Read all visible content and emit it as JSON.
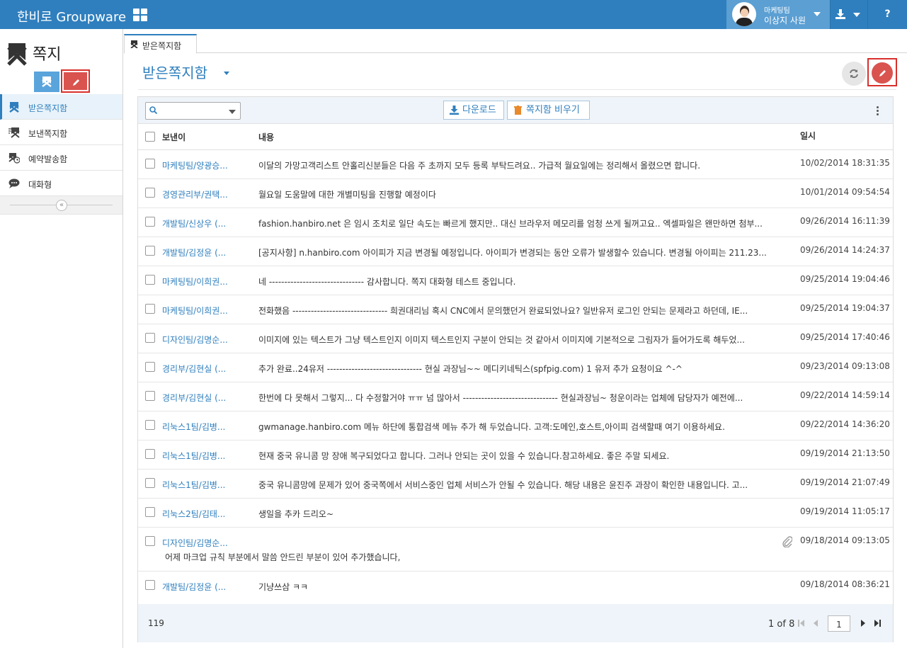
{
  "header": {
    "brand": "한비로 Groupware",
    "user_team": "마케팅팀",
    "user_name": "이상지 사원",
    "help_label": "?"
  },
  "sidebar": {
    "title": "쪽지",
    "items": [
      {
        "label": "받은쪽지함",
        "icon": "inbox-icon",
        "active": true
      },
      {
        "label": "보낸쪽지함",
        "icon": "sent-icon",
        "active": false
      },
      {
        "label": "예약발송함",
        "icon": "scheduled-icon",
        "active": false
      },
      {
        "label": "대화형",
        "icon": "chat-icon",
        "active": false
      }
    ]
  },
  "tab": {
    "label": "받은쪽지함"
  },
  "main": {
    "title": "받은쪽지함",
    "toolbar": {
      "search_placeholder": "",
      "download_label": "다운로드",
      "empty_label": "쪽지함 비우기"
    },
    "columns": {
      "sender": "보낸이",
      "content": "내용",
      "date": "일시"
    },
    "rows": [
      {
        "sender": "마케팅팀/양광승...",
        "content": "이달의 가망고객리스트 안홀리신분들은 다음 주 초까지 모두 등록 부탁드려요.. 가급적 월요일에는 정리해서 올렸으면 합니다.",
        "date": "10/02/2014 18:31:35"
      },
      {
        "sender": "경영관리부/권택...",
        "content": "월요일 도움말에 대한 개별미팅을 진행할 예정이다",
        "date": "10/01/2014 09:54:54"
      },
      {
        "sender": "개발팀/신상우 (...",
        "content": "fashion.hanbiro.net 은 임시 조치로 일단 속도는 빠르게 했지만.. 대신 브라우저 메모리를 엄청 쓰게 될꺼고요.. 엑셀파일은 왠만하면 첨부...",
        "date": "09/26/2014 16:11:39"
      },
      {
        "sender": "개발팀/김정윤 (...",
        "content": "[공지사항] n.hanbiro.com 아이피가 지금 변경될 예정입니다. 아이피가 변경되는 동안 오류가 발생할수 있습니다. 변경될 아이피는 211.23...",
        "date": "09/26/2014 14:24:37"
      },
      {
        "sender": "마케팅팀/이희권...",
        "content": "네 ------------------------------- 감사합니다. 쪽지 대화형 테스트 중입니다.",
        "date": "09/25/2014 19:04:46"
      },
      {
        "sender": "마케팅팀/이희권...",
        "content": "전화했음 ------------------------------- 희권대리님 혹시 CNC에서 문의했던거 완료되었나요? 일반유저 로그인 안되는 문제라고 하던데, IE...",
        "date": "09/25/2014 19:04:37"
      },
      {
        "sender": "디자인팀/김명순...",
        "content": "이미지에 있는 텍스트가 그냥 텍스트인지 이미지 텍스트인지 구분이 안되는 것 같아서 이미지에 기본적으로 그림자가 들어가도록 해두었...",
        "date": "09/25/2014 17:40:46"
      },
      {
        "sender": "경리부/김현실 (...",
        "content": "추가 완료..24유저 ------------------------------- 현실 과장님~~ 메디키네틱스(spfpig.com) 1 유저 추가 요청이요 ^-^",
        "date": "09/23/2014 09:13:08"
      },
      {
        "sender": "경리부/김현실 (...",
        "content": "한번에 다 못해서 그렇지... 다 수정할거야 ㅠㅠ 넘 많아서 ------------------------------- 현실과장님~ 청운이라는 업체에 담당자가 예전에...",
        "date": "09/22/2014 14:59:14"
      },
      {
        "sender": "리눅스1팀/김병...",
        "content": "gwmanage.hanbiro.com 메뉴 하단에 통합검색 메뉴 추가 해 두었습니다. 고객:도메인,호스트,아이피 검색할때 여기 이용하세요.",
        "date": "09/22/2014 14:36:20"
      },
      {
        "sender": "리눅스1팀/김병...",
        "content": "현재 중국 유니콤 망 장애 복구되었다고 합니다. 그러나 안되는 곳이 있을 수 있습니다.참고하세요. 좋은 주말 되세요.",
        "date": "09/19/2014 21:13:50"
      },
      {
        "sender": "리눅스1팀/김병...",
        "content": "중국 유니콤망에 문제가 있어 중국쪽에서 서비스중인 업체 서비스가 안될 수 있습니다. 해당 내용은 윤진주 과장이 확인한 내용입니다. 고...",
        "date": "09/19/2014 21:07:49"
      },
      {
        "sender": "리눅스2팀/김태...",
        "content": "생일을 추카 드리오~",
        "date": "09/19/2014 11:05:17"
      },
      {
        "sender": "디자인팀/김명순...",
        "content": "어제 마크업 규칙 부분에서 말씀 안드린 부분이 있어 추가했습니다,",
        "date": "09/18/2014 09:13:05",
        "attachment": true
      },
      {
        "sender": "개발팀/김정윤 (...",
        "content": "기냥쓰삼 ㅋㅋ",
        "date": "09/18/2014 08:36:21"
      }
    ],
    "footer": {
      "total": "119",
      "page_info": "1 of 8",
      "page_value": "1"
    }
  },
  "colors": {
    "primary": "#2f7fbe",
    "danger": "#d9534f",
    "highlight_border": "#d9302c"
  }
}
